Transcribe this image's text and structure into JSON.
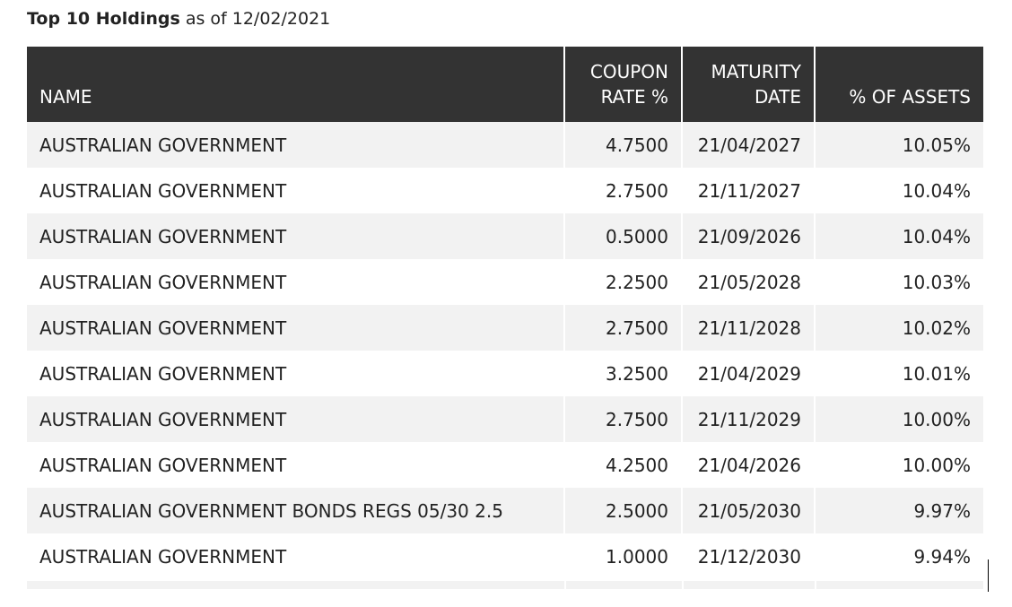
{
  "header": {
    "title_bold": "Top 10 Holdings",
    "title_suffix": " as of 12/02/2021"
  },
  "table": {
    "columns": {
      "name": "NAME",
      "coupon_line1": "COUPON",
      "coupon_line2": "RATE %",
      "maturity_line1": "MATURITY",
      "maturity_line2": "DATE",
      "assets": "% OF ASSETS"
    },
    "rows": [
      {
        "name": "AUSTRALIAN GOVERNMENT",
        "coupon": "4.7500",
        "maturity": "21/04/2027",
        "assets": "10.05%"
      },
      {
        "name": "AUSTRALIAN GOVERNMENT",
        "coupon": "2.7500",
        "maturity": "21/11/2027",
        "assets": "10.04%"
      },
      {
        "name": "AUSTRALIAN GOVERNMENT",
        "coupon": "0.5000",
        "maturity": "21/09/2026",
        "assets": "10.04%"
      },
      {
        "name": "AUSTRALIAN GOVERNMENT",
        "coupon": "2.2500",
        "maturity": "21/05/2028",
        "assets": "10.03%"
      },
      {
        "name": "AUSTRALIAN GOVERNMENT",
        "coupon": "2.7500",
        "maturity": "21/11/2028",
        "assets": "10.02%"
      },
      {
        "name": "AUSTRALIAN GOVERNMENT",
        "coupon": "3.2500",
        "maturity": "21/04/2029",
        "assets": "10.01%"
      },
      {
        "name": "AUSTRALIAN GOVERNMENT",
        "coupon": "2.7500",
        "maturity": "21/11/2029",
        "assets": "10.00%"
      },
      {
        "name": "AUSTRALIAN GOVERNMENT",
        "coupon": "4.2500",
        "maturity": "21/04/2026",
        "assets": "10.00%"
      },
      {
        "name": "AUSTRALIAN GOVERNMENT BONDS REGS 05/30 2.5",
        "coupon": "2.5000",
        "maturity": "21/05/2030",
        "assets": "9.97%"
      },
      {
        "name": "AUSTRALIAN GOVERNMENT",
        "coupon": "1.0000",
        "maturity": "21/12/2030",
        "assets": "9.94%"
      }
    ]
  },
  "colors": {
    "header_bg": "#333333",
    "header_text": "#ffffff",
    "stripe_bg": "#f2f2f2",
    "body_text": "#222222"
  }
}
